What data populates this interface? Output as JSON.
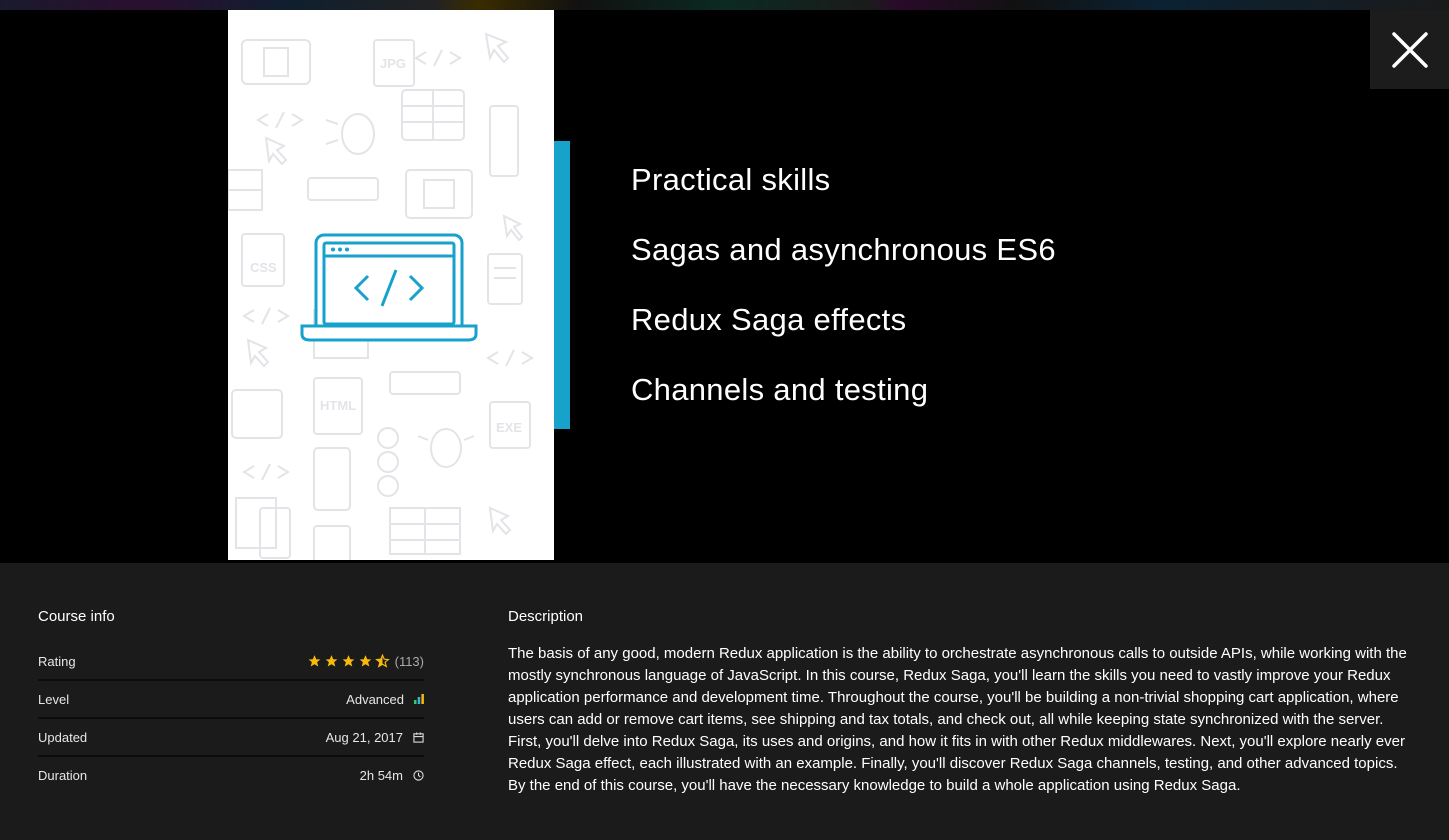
{
  "slide": {
    "lines": [
      "Practical skills",
      "Sagas and asynchronous ES6",
      "Redux Saga effects",
      "Channels and testing"
    ],
    "pattern_labels": {
      "jpg": "JPG",
      "css": "CSS",
      "html": "HTML",
      "exe": "EXE"
    },
    "accent_color": "#17a2cc"
  },
  "close": {
    "icon": "close-icon"
  },
  "course_info": {
    "title": "Course info",
    "rating": {
      "label": "Rating",
      "stars": 4.5,
      "count": "(113)",
      "star_color": "#f6b90c"
    },
    "level": {
      "label": "Level",
      "value": "Advanced",
      "icon": "level-bars-icon"
    },
    "updated": {
      "label": "Updated",
      "value": "Aug 21, 2017",
      "icon": "calendar-icon"
    },
    "duration": {
      "label": "Duration",
      "value": "2h 54m",
      "icon": "clock-icon"
    }
  },
  "description": {
    "title": "Description",
    "text": "The basis of any good, modern Redux application is the ability to orchestrate asynchronous calls to outside APIs, while working with the mostly synchronous language of JavaScript. In this course, Redux Saga, you'll learn the skills you need to vastly improve your Redux application performance and development time. Throughout the course, you'll be building a non-trivial shopping cart application, where users can add or remove cart items, see shipping and tax totals, and check out, all while keeping state synchronized with the server. First, you'll delve into Redux Saga, its uses and origins, and how it fits in with other Redux middlewares. Next, you'll explore nearly ever Redux Saga effect, each illustrated with an example. Finally, you'll discover Redux Saga channels, testing, and other advanced topics. By the end of this course, you'll have the necessary knowledge to build a whole application using Redux Saga."
  }
}
